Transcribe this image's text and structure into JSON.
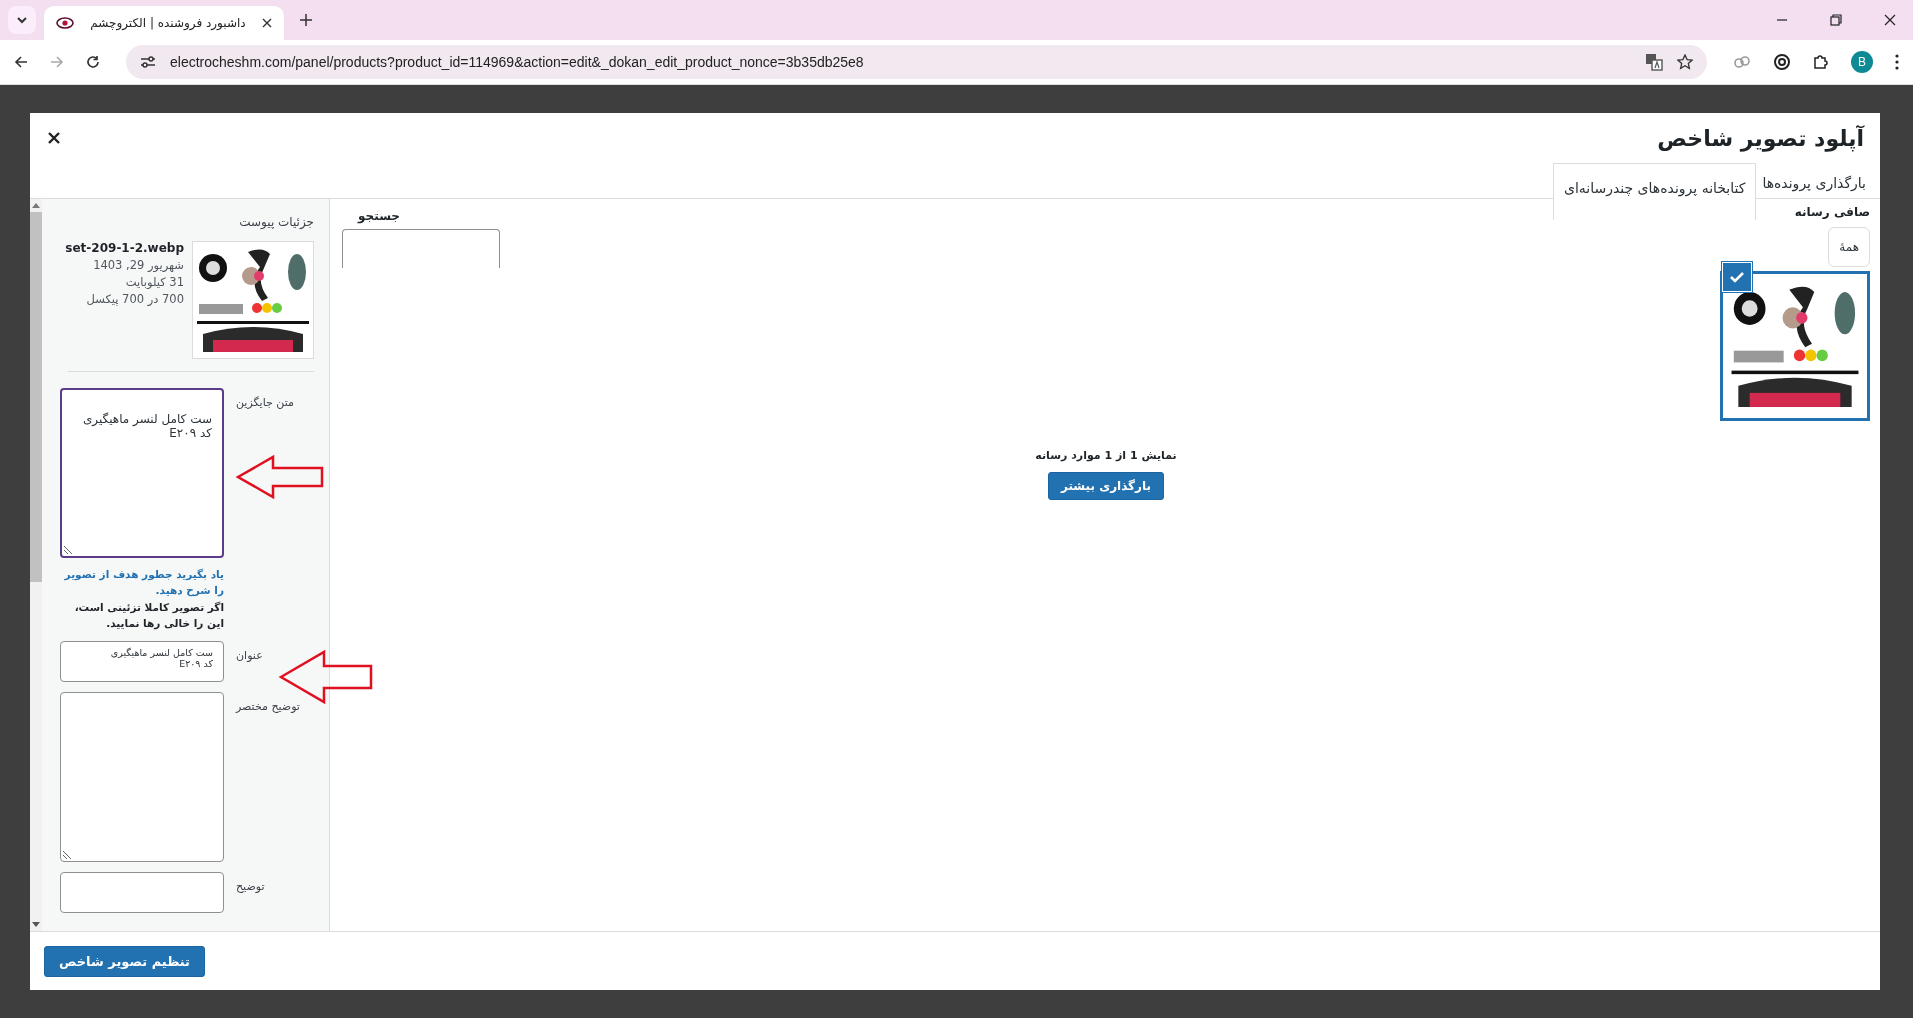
{
  "browser": {
    "tab_title": "داشبورد فروشنده | الکتروچشم",
    "url": "electrocheshm.com/panel/products?product_id=114969&action=edit&_dokan_edit_product_nonce=3b35db25e8",
    "profile_initial": "B"
  },
  "modal": {
    "title": "آپلود تصویر شاخص",
    "tabs": [
      {
        "label": "بارگذاری پرونده‌ها",
        "selected": false
      },
      {
        "label": "کتابخانه پرونده‌های چندرسانه‌ای",
        "selected": true
      }
    ],
    "filter": {
      "label": "صافی رسانه",
      "value": "همهٔ"
    },
    "search": {
      "label": "جستجو"
    },
    "media_items": [
      {
        "kind": "picture",
        "selected": true
      }
    ],
    "count_text": "نمایش 1 از 1 موارد رسانه",
    "load_more": "بارگذاری بیشتر",
    "details": {
      "heading": "جزئیات پیوست",
      "filename": "set-209-1-2.webp",
      "date": "شهریور 29, 1403",
      "size": "31 کیلوبایت",
      "dimensions": "700 در 700 پیکسل"
    },
    "fields": [
      {
        "kind": "tall",
        "label": "متن جایگزین",
        "value": "ست کامل لنسر ماهیگیری\nکد E۲۰۹",
        "focused": true,
        "help": {
          "link": "یاد بگیرید جطور هدف از تصویر را شرح دهید.",
          "text": "اگر تصویر کاملا تزئینی است، این را خالی رها نمایید."
        }
      },
      {
        "kind": "short",
        "label": "عنوان",
        "value": "ست کامل لنسر ماهیگیری\nکد E۲۰۹",
        "focused": false
      },
      {
        "kind": "tall",
        "label": "توضیح مختصر",
        "focused": false
      },
      {
        "kind": "short",
        "label": "توضیح",
        "focused": false
      }
    ],
    "submit": "تنظیم تصویر شاخص"
  }
}
